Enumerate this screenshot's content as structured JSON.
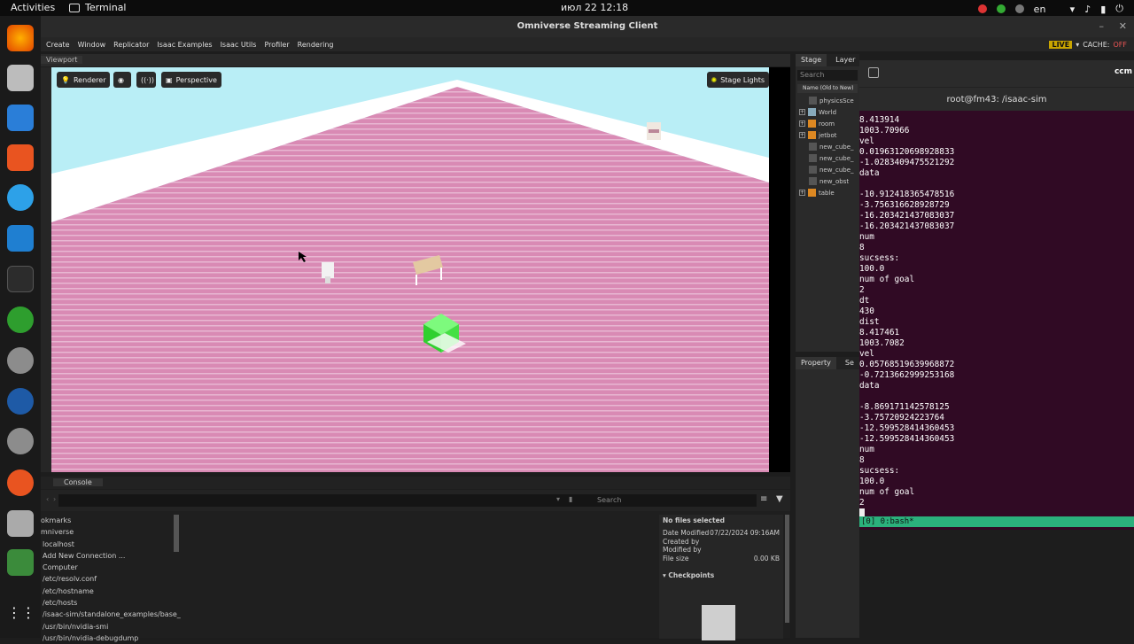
{
  "topbar": {
    "activities": "Activities",
    "app_name": "Terminal",
    "clock": "июл 22  12:18",
    "lang": "en"
  },
  "window": {
    "title": "Omniverse Streaming Client"
  },
  "menu": {
    "items": [
      "Create",
      "Window",
      "Replicator",
      "Isaac Examples",
      "Isaac Utils",
      "Profiler",
      "Rendering"
    ],
    "live": "LIVE",
    "cache_label": "CACHE:",
    "cache_state": "OFF"
  },
  "viewport": {
    "tab": "Viewport",
    "renderer": "Renderer",
    "camera": "Perspective",
    "lights": "Stage Lights"
  },
  "stage": {
    "tabs": [
      "Stage",
      "Layer"
    ],
    "search_placeholder": "Search",
    "column_header": "Name (Old to New)",
    "items": [
      "physicsSce",
      "World",
      "room",
      "jetbot",
      "new_cube_",
      "new_cube_",
      "new_cube_",
      "new_obst",
      "table"
    ]
  },
  "property": {
    "tabs": [
      "Property",
      "Se"
    ]
  },
  "terminal": {
    "user_hint": "ccm",
    "title": "root@fm43: /isaac-sim",
    "lines": [
      "8.413914",
      "1003.70966",
      "vel",
      "0.01963120698928833",
      "-1.0283409475521292",
      "data",
      "",
      "-10.912418365478516",
      "-3.756316628928729",
      "-16.203421437083037",
      "-16.203421437083037",
      "num",
      "8",
      "sucsess:",
      "100.0",
      "num of goal",
      "2",
      "dt",
      "430",
      "dist",
      "8.417461",
      "1003.7082",
      "vel",
      "0.05768519639968872",
      "-0.7213662999253168",
      "data",
      "",
      "-8.869171142578125",
      "-3.75720924223764",
      "-12.599528414360453",
      "-12.599528414360453",
      "num",
      "8",
      "sucsess:",
      "100.0",
      "num of goal",
      "2"
    ],
    "tmux_status": "[0] 0:bash*"
  },
  "console": {
    "tab": "Console",
    "search_placeholder": "Search"
  },
  "browser": {
    "items": [
      "okmarks",
      "mniverse",
      "localhost",
      "Add New Connection ...",
      "Computer",
      "/etc/resolv.conf",
      "/etc/hostname",
      "/etc/hosts",
      "/isaac-sim/standalone_examples/base_a",
      "/usr/bin/nvidia-smi",
      "/usr/bin/nvidia-debugdump"
    ]
  },
  "details": {
    "header": "No files selected",
    "date_modified_label": "Date Modified",
    "date_modified": "07/22/2024 09:16AM",
    "created_by_label": "Created by",
    "modified_by_label": "Modified by",
    "file_size_label": "File size",
    "file_size": "0.00 KB",
    "checkpoints": "Checkpoints"
  },
  "colors": {
    "accent_live": "#c9a500",
    "terminal_bg": "#300a24",
    "tmux_bar": "#2bb07c",
    "floor": "#d98ab4",
    "cube": "#44e044"
  }
}
